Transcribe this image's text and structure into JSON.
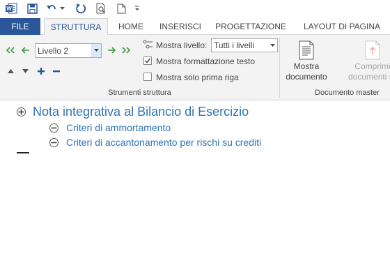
{
  "quick_access": {
    "icons": [
      "word-logo-icon",
      "save-icon",
      "undo-icon",
      "undo-dropdown-icon",
      "redo-icon",
      "print-preview-icon",
      "new-document-icon",
      "customize-qat-icon"
    ]
  },
  "tabs": {
    "file": "FILE",
    "items": [
      "STRUTTURA",
      "HOME",
      "INSERISCI",
      "PROGETTAZIONE",
      "LAYOUT DI PAGINA"
    ],
    "active": "STRUTTURA"
  },
  "ribbon": {
    "level_value": "Livello 2",
    "show_level_label": "Mostra livello:",
    "show_level_value": "Tutti i livelli",
    "show_formatting_label": "Mostra formattazione testo",
    "show_formatting_checked": true,
    "first_line_label": "Mostra solo prima riga",
    "first_line_checked": false,
    "group_outline": "Strumenti struttura",
    "show_document": [
      "Mostra",
      "documento"
    ],
    "collapse_subdocs": [
      "Comprimi",
      "documenti seco"
    ],
    "group_master": "Documento master"
  },
  "document": {
    "heading1": "Nota integrativa al Bilancio di Esercizio",
    "heading2_items": [
      "Criteri di ammortamento",
      "Criteri di accantonamento per rischi su crediti"
    ]
  },
  "colors": {
    "file_tab": "#2b579a",
    "heading": "#2e74b5",
    "ribbon_bg": "#f3f3f3",
    "arrow_green": "#3a9a3a",
    "blue_icon": "#2b579a"
  }
}
